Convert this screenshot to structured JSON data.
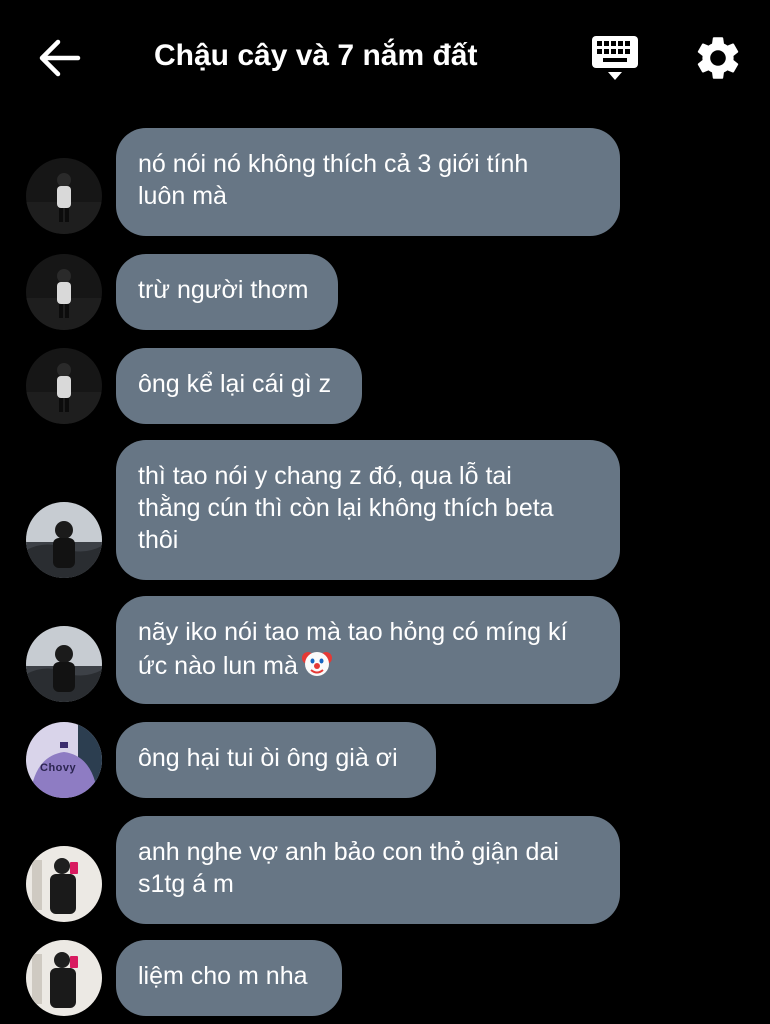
{
  "header": {
    "title": "Chậu cây và 7 nắm đất",
    "back_icon": "arrow-left-icon",
    "keyboard_icon": "keyboard-icon",
    "settings_icon": "gear-icon"
  },
  "colors": {
    "background": "#000000",
    "bubble": "#677685",
    "text": "#ffffff"
  },
  "messages": [
    {
      "text": "nó nói nó không thích cả 3 giới tính\nluôn mà",
      "avatar": "avatar-dark-figure"
    },
    {
      "text": "trừ người thơm",
      "avatar": "avatar-dark-figure"
    },
    {
      "text": "ông kể lại cái gì z",
      "avatar": "avatar-dark-figure"
    },
    {
      "text": "thì tao nói y chang z đó, qua lỗ tai\nthằng cún thì còn lại không thích beta\nthôi",
      "avatar": "avatar-boy-sky"
    },
    {
      "text": "nãy iko nói tao mà tao hỏng có míng kí\nức nào lun mà",
      "avatar": "avatar-boy-sky",
      "emoji": "clown-face-icon"
    },
    {
      "text": "ông hại tui òi ông già ơi",
      "avatar": "avatar-chovy",
      "avatar_text": "Chovy"
    },
    {
      "text": "anh nghe vợ anh bảo con thỏ giận dai\ns1tg á m",
      "avatar": "avatar-mirror-selfie"
    },
    {
      "text": "liệm cho m nha",
      "avatar": "avatar-mirror-selfie"
    }
  ]
}
